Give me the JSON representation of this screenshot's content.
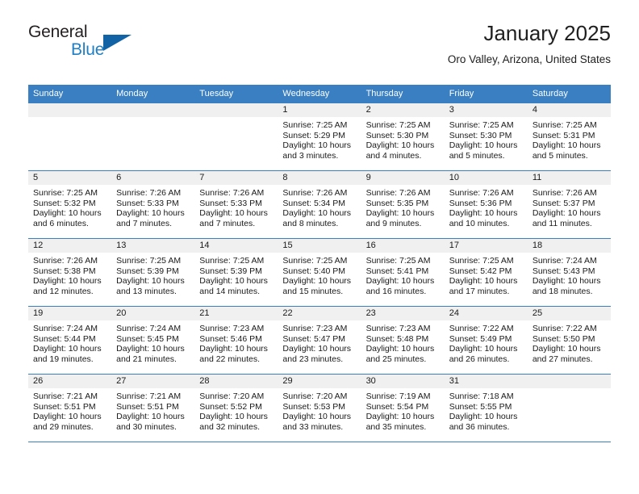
{
  "brand": {
    "name_top": "General",
    "name_bottom": "Blue",
    "triangle_color": "#1263a5",
    "blue_color": "#1f7fc4"
  },
  "header": {
    "title": "January 2025",
    "location": "Oro Valley, Arizona, United States"
  },
  "theme": {
    "header_blue": "#3a7fc1",
    "daynum_band": "#f0f0f0",
    "text": "#1a1a1a"
  },
  "weekday_headers": [
    "Sunday",
    "Monday",
    "Tuesday",
    "Wednesday",
    "Thursday",
    "Friday",
    "Saturday"
  ],
  "labels": {
    "sunrise": "Sunrise:",
    "sunset": "Sunset:",
    "daylight": "Daylight:"
  },
  "weeks": [
    [
      {
        "day": "",
        "sunrise": "",
        "sunset": "",
        "daylight": "",
        "blank": true
      },
      {
        "day": "",
        "sunrise": "",
        "sunset": "",
        "daylight": "",
        "blank": true
      },
      {
        "day": "",
        "sunrise": "",
        "sunset": "",
        "daylight": "",
        "blank": true
      },
      {
        "day": "1",
        "sunrise": "Sunrise: 7:25 AM",
        "sunset": "Sunset: 5:29 PM",
        "daylight": "Daylight: 10 hours and 3 minutes."
      },
      {
        "day": "2",
        "sunrise": "Sunrise: 7:25 AM",
        "sunset": "Sunset: 5:30 PM",
        "daylight": "Daylight: 10 hours and 4 minutes."
      },
      {
        "day": "3",
        "sunrise": "Sunrise: 7:25 AM",
        "sunset": "Sunset: 5:30 PM",
        "daylight": "Daylight: 10 hours and 5 minutes."
      },
      {
        "day": "4",
        "sunrise": "Sunrise: 7:25 AM",
        "sunset": "Sunset: 5:31 PM",
        "daylight": "Daylight: 10 hours and 5 minutes."
      }
    ],
    [
      {
        "day": "5",
        "sunrise": "Sunrise: 7:25 AM",
        "sunset": "Sunset: 5:32 PM",
        "daylight": "Daylight: 10 hours and 6 minutes."
      },
      {
        "day": "6",
        "sunrise": "Sunrise: 7:26 AM",
        "sunset": "Sunset: 5:33 PM",
        "daylight": "Daylight: 10 hours and 7 minutes."
      },
      {
        "day": "7",
        "sunrise": "Sunrise: 7:26 AM",
        "sunset": "Sunset: 5:33 PM",
        "daylight": "Daylight: 10 hours and 7 minutes."
      },
      {
        "day": "8",
        "sunrise": "Sunrise: 7:26 AM",
        "sunset": "Sunset: 5:34 PM",
        "daylight": "Daylight: 10 hours and 8 minutes."
      },
      {
        "day": "9",
        "sunrise": "Sunrise: 7:26 AM",
        "sunset": "Sunset: 5:35 PM",
        "daylight": "Daylight: 10 hours and 9 minutes."
      },
      {
        "day": "10",
        "sunrise": "Sunrise: 7:26 AM",
        "sunset": "Sunset: 5:36 PM",
        "daylight": "Daylight: 10 hours and 10 minutes."
      },
      {
        "day": "11",
        "sunrise": "Sunrise: 7:26 AM",
        "sunset": "Sunset: 5:37 PM",
        "daylight": "Daylight: 10 hours and 11 minutes."
      }
    ],
    [
      {
        "day": "12",
        "sunrise": "Sunrise: 7:26 AM",
        "sunset": "Sunset: 5:38 PM",
        "daylight": "Daylight: 10 hours and 12 minutes."
      },
      {
        "day": "13",
        "sunrise": "Sunrise: 7:25 AM",
        "sunset": "Sunset: 5:39 PM",
        "daylight": "Daylight: 10 hours and 13 minutes."
      },
      {
        "day": "14",
        "sunrise": "Sunrise: 7:25 AM",
        "sunset": "Sunset: 5:39 PM",
        "daylight": "Daylight: 10 hours and 14 minutes."
      },
      {
        "day": "15",
        "sunrise": "Sunrise: 7:25 AM",
        "sunset": "Sunset: 5:40 PM",
        "daylight": "Daylight: 10 hours and 15 minutes."
      },
      {
        "day": "16",
        "sunrise": "Sunrise: 7:25 AM",
        "sunset": "Sunset: 5:41 PM",
        "daylight": "Daylight: 10 hours and 16 minutes."
      },
      {
        "day": "17",
        "sunrise": "Sunrise: 7:25 AM",
        "sunset": "Sunset: 5:42 PM",
        "daylight": "Daylight: 10 hours and 17 minutes."
      },
      {
        "day": "18",
        "sunrise": "Sunrise: 7:24 AM",
        "sunset": "Sunset: 5:43 PM",
        "daylight": "Daylight: 10 hours and 18 minutes."
      }
    ],
    [
      {
        "day": "19",
        "sunrise": "Sunrise: 7:24 AM",
        "sunset": "Sunset: 5:44 PM",
        "daylight": "Daylight: 10 hours and 19 minutes."
      },
      {
        "day": "20",
        "sunrise": "Sunrise: 7:24 AM",
        "sunset": "Sunset: 5:45 PM",
        "daylight": "Daylight: 10 hours and 21 minutes."
      },
      {
        "day": "21",
        "sunrise": "Sunrise: 7:23 AM",
        "sunset": "Sunset: 5:46 PM",
        "daylight": "Daylight: 10 hours and 22 minutes."
      },
      {
        "day": "22",
        "sunrise": "Sunrise: 7:23 AM",
        "sunset": "Sunset: 5:47 PM",
        "daylight": "Daylight: 10 hours and 23 minutes."
      },
      {
        "day": "23",
        "sunrise": "Sunrise: 7:23 AM",
        "sunset": "Sunset: 5:48 PM",
        "daylight": "Daylight: 10 hours and 25 minutes."
      },
      {
        "day": "24",
        "sunrise": "Sunrise: 7:22 AM",
        "sunset": "Sunset: 5:49 PM",
        "daylight": "Daylight: 10 hours and 26 minutes."
      },
      {
        "day": "25",
        "sunrise": "Sunrise: 7:22 AM",
        "sunset": "Sunset: 5:50 PM",
        "daylight": "Daylight: 10 hours and 27 minutes."
      }
    ],
    [
      {
        "day": "26",
        "sunrise": "Sunrise: 7:21 AM",
        "sunset": "Sunset: 5:51 PM",
        "daylight": "Daylight: 10 hours and 29 minutes."
      },
      {
        "day": "27",
        "sunrise": "Sunrise: 7:21 AM",
        "sunset": "Sunset: 5:51 PM",
        "daylight": "Daylight: 10 hours and 30 minutes."
      },
      {
        "day": "28",
        "sunrise": "Sunrise: 7:20 AM",
        "sunset": "Sunset: 5:52 PM",
        "daylight": "Daylight: 10 hours and 32 minutes."
      },
      {
        "day": "29",
        "sunrise": "Sunrise: 7:20 AM",
        "sunset": "Sunset: 5:53 PM",
        "daylight": "Daylight: 10 hours and 33 minutes."
      },
      {
        "day": "30",
        "sunrise": "Sunrise: 7:19 AM",
        "sunset": "Sunset: 5:54 PM",
        "daylight": "Daylight: 10 hours and 35 minutes."
      },
      {
        "day": "31",
        "sunrise": "Sunrise: 7:18 AM",
        "sunset": "Sunset: 5:55 PM",
        "daylight": "Daylight: 10 hours and 36 minutes."
      },
      {
        "day": "",
        "sunrise": "",
        "sunset": "",
        "daylight": "",
        "blank": true
      }
    ]
  ]
}
